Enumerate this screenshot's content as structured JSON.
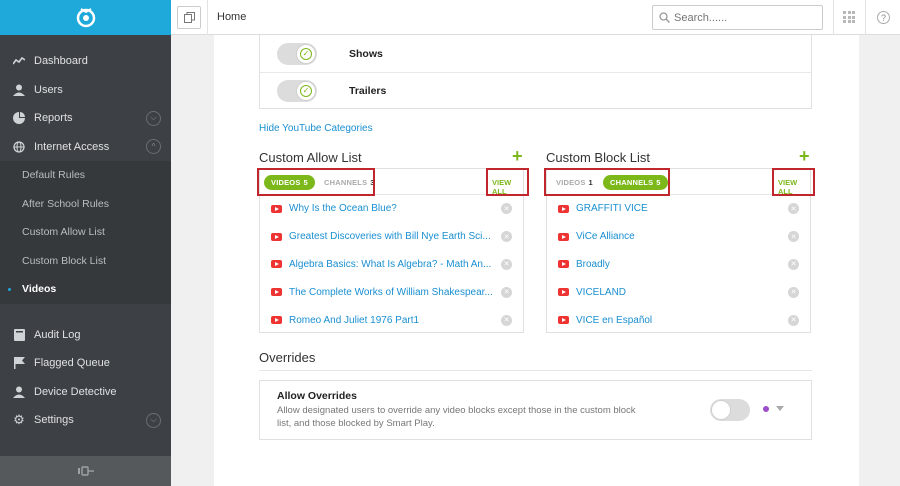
{
  "sidebar": {
    "items": [
      {
        "label": "Dashboard",
        "icon": "chart-line-icon"
      },
      {
        "label": "Users",
        "icon": "user-icon"
      },
      {
        "label": "Reports",
        "icon": "pie-chart-icon"
      },
      {
        "label": "Internet Access",
        "icon": "globe-icon"
      }
    ],
    "subitems": [
      {
        "label": "Default Rules"
      },
      {
        "label": "After School Rules"
      },
      {
        "label": "Custom Allow List"
      },
      {
        "label": "Custom Block List"
      },
      {
        "label": "Videos"
      }
    ],
    "items2": [
      {
        "label": "Audit Log",
        "icon": "book-icon"
      },
      {
        "label": "Flagged Queue",
        "icon": "flag-icon"
      },
      {
        "label": "Device Detective",
        "icon": "user-icon"
      },
      {
        "label": "Settings",
        "icon": "gear-icon"
      }
    ]
  },
  "header": {
    "breadcrumb": "Home",
    "search_placeholder": "Search......"
  },
  "categories": [
    {
      "label": "Shows",
      "enabled": true
    },
    {
      "label": "Trailers",
      "enabled": true
    }
  ],
  "hide_categories_link": "Hide YouTube Categories",
  "allow_list": {
    "title": "Custom Allow List",
    "tabs": [
      {
        "label": "VIDEOS",
        "count": "5"
      },
      {
        "label": "CHANNELS",
        "count": "3"
      }
    ],
    "view_all": "VIEW ALL",
    "items": [
      "Why Is the Ocean Blue?",
      "Greatest Discoveries with Bill Nye Earth Sci...",
      "Algebra Basics: What Is Algebra? - Math An...",
      "The Complete Works of William Shakespear...",
      "Romeo And Juliet 1976 Part1"
    ]
  },
  "block_list": {
    "title": "Custom Block List",
    "tabs": [
      {
        "label": "VIDEOS",
        "count": "1"
      },
      {
        "label": "CHANNELS",
        "count": "5"
      }
    ],
    "view_all": "VIEW ALL",
    "items": [
      "GRAFFITI VICE",
      "ViCe Alliance",
      "Broadly",
      "VICELAND",
      "VICE en Español"
    ]
  },
  "overrides": {
    "title": "Overrides",
    "heading": "Allow Overrides",
    "description": "Allow designated users to override any video blocks except those in the custom block list, and those blocked by Smart Play.",
    "enabled": false
  },
  "colors": {
    "accent_blue": "#1fa8da",
    "sidebar_bg": "#3d4145",
    "green": "#7cb81a",
    "link": "#1a8fd1",
    "highlight_red": "#c0272d"
  }
}
